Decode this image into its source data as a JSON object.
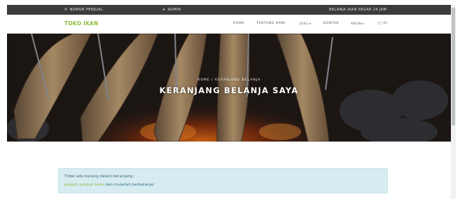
{
  "topbar": {
    "phone_label": "NOMOR PENJUAL",
    "admin_label": "ADMIN",
    "fresh_label": "BELANJA IKAN SEGAR 24 JAM"
  },
  "navbar": {
    "brand": "TOKO IKAN",
    "menu": [
      {
        "label": "HOME"
      },
      {
        "label": "TENTANG KAMI"
      },
      {
        "label": "JUAL"
      },
      {
        "label": "KONTAK"
      },
      {
        "label": "AKUN"
      },
      {
        "label": "(0)"
      }
    ]
  },
  "hero": {
    "breadcrumb": "HOME / KERANJANG BELANJA",
    "title": "KERANJANG BELANJA SAYA"
  },
  "alert": {
    "line1": "Tidak ada barang dalam keranjang.",
    "link": "Jelajahi produk kami",
    "line2_rest": " dan mulailah berbelanja!"
  },
  "colors": {
    "brand": "#8bbf3f",
    "topbar": "#3b3b3b",
    "alert_bg": "#d6ecf1"
  }
}
